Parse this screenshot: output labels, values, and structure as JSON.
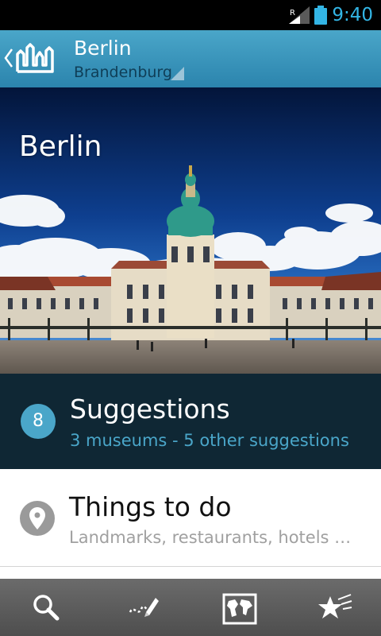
{
  "status_bar": {
    "time": "9:40",
    "signal_badge": "R",
    "icons": [
      "signal-icon",
      "battery-icon"
    ]
  },
  "action_bar": {
    "title": "Berlin",
    "subtitle": "Brandenburg",
    "icons": [
      "back-chevron-icon",
      "city-skyline-logo-icon",
      "spinner-indicator-icon"
    ]
  },
  "hero": {
    "title": "Berlin",
    "image": "charlottenburg-palace-photo"
  },
  "suggestions": {
    "count": "8",
    "title": "Suggestions",
    "subtitle": "3 museums - 5 other suggestions"
  },
  "things_to_do": {
    "title": "Things to do",
    "subtitle": "Landmarks, restaurants, hotels …",
    "icon": "location-pin-icon"
  },
  "bottom_bar": {
    "buttons": [
      "search-icon",
      "edit-notes-icon",
      "world-map-icon",
      "favorites-star-icon"
    ]
  },
  "colors": {
    "accent": "#33b5e5",
    "action_bar": "#3a95be",
    "suggestions_bg": "#0f2734",
    "suggestions_accent": "#4aa6c9",
    "pin_grey": "#9a9a9a",
    "bottom_bar": "#5a5a5a"
  }
}
